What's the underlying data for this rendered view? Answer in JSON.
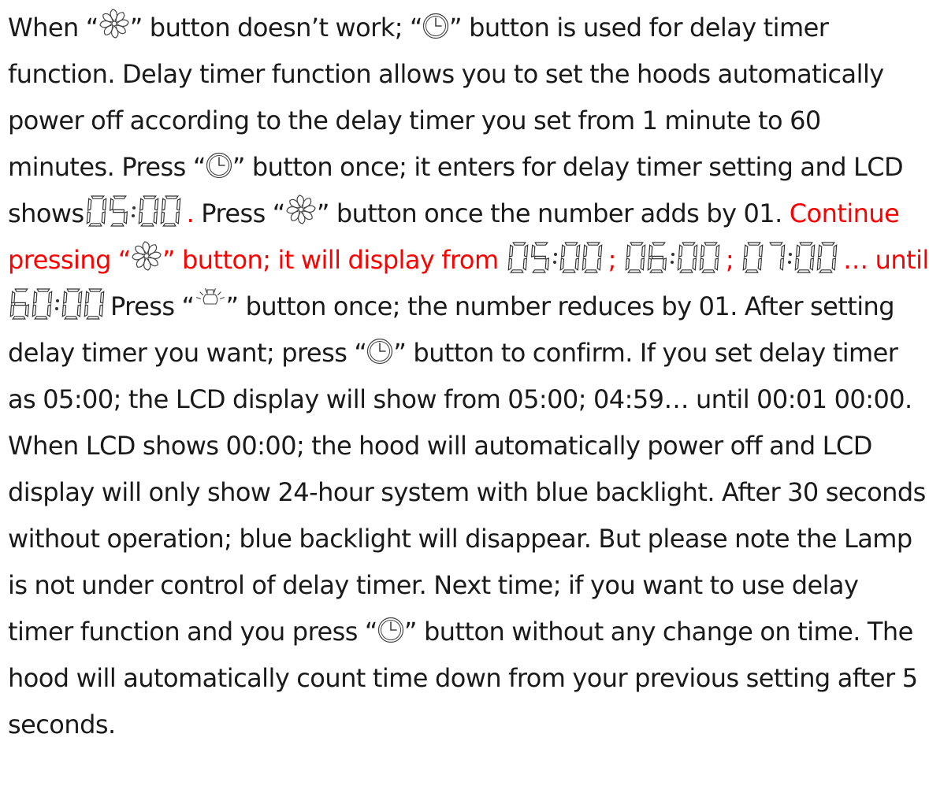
{
  "icons": {
    "fan": "fan-icon",
    "clock": "clock-icon",
    "lamp": "lamp-icon"
  },
  "colors": {
    "text": "#1a1a1a",
    "highlight": "#ff0000"
  },
  "text": {
    "s01": "When “",
    "s02": "” button doesn’t work; “",
    "s03": "” button is used for delay timer function. Delay timer function allows you to set the hoods automatically power off according to the delay timer you set from 1 minute to 60 minutes. Press “",
    "s04": "” button once; it enters for delay timer setting and LCD shows",
    "s05": ".",
    "s06": " Press “",
    "s07": "” button once the number adds by 01. ",
    "s08": "Continue pressing “",
    "s09": "” button; it will display from ",
    "s10": "; ",
    "s11": "; ",
    "s12": "… until ",
    "s13": "Press “",
    "s14": "” button once; the number reduces by 01. After setting delay timer you want; press “",
    "s15": "” button to confirm. If you set delay timer as 05:00; the LCD display will show from 05:00; 04:59… until 00:01 00:00. When LCD shows 00:00; the hood will automatically power off and LCD display will only show 24-hour system with blue backlight. After 30 seconds without operation; blue backlight will disappear. But please note the Lamp is not under control of delay timer. Next time; if you want to use delay timer function and you press “",
    "s16": "” button without any change on time. The hood will automatically count time down from your previous setting after 5 seconds."
  },
  "lcd_values": {
    "v1": "05:00",
    "v2": "05:00",
    "v3": "06:00",
    "v4": "07:00",
    "v5": "60:00"
  }
}
